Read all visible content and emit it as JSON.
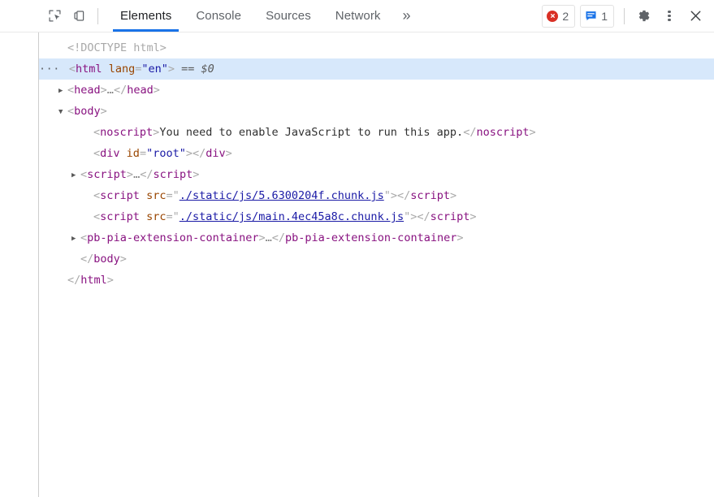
{
  "toolbar": {
    "inspect_icon": "inspect-element-icon",
    "device_icon": "device-toolbar-icon",
    "tabs": [
      {
        "label": "Elements",
        "active": true
      },
      {
        "label": "Console",
        "active": false
      },
      {
        "label": "Sources",
        "active": false
      },
      {
        "label": "Network",
        "active": false
      }
    ],
    "overflow_label": "»",
    "error_count": "2",
    "message_count": "1",
    "settings_icon": "gear-icon",
    "more_icon": "kebab-menu-icon",
    "close_icon": "close-icon",
    "accent_color": "#1a73e8",
    "error_color": "#d93025",
    "message_color": "#1a73e8"
  },
  "dom": {
    "selected_suffix": "== $0",
    "rows": [
      {
        "indent": 1,
        "twisty": "none",
        "leading_dots": false,
        "selected": false,
        "parts": [
          {
            "t": "doctype",
            "v": "<!DOCTYPE html>"
          }
        ]
      },
      {
        "indent": 0,
        "twisty": "none",
        "leading_dots": true,
        "selected": true,
        "parts": [
          {
            "t": "pnct",
            "v": "<"
          },
          {
            "t": "tag",
            "v": "html"
          },
          {
            "t": "pnct",
            "v": " "
          },
          {
            "t": "attn",
            "v": "lang"
          },
          {
            "t": "pnct",
            "v": "="
          },
          {
            "t": "attv",
            "v": "\"en\""
          },
          {
            "t": "pnct",
            "v": ">"
          },
          {
            "t": "sel0",
            "v": " == $0"
          }
        ]
      },
      {
        "indent": 1,
        "twisty": "closed",
        "leading_dots": false,
        "selected": false,
        "parts": [
          {
            "t": "pnct",
            "v": "<"
          },
          {
            "t": "tag",
            "v": "head"
          },
          {
            "t": "pnct",
            "v": ">"
          },
          {
            "t": "ellip",
            "v": "…"
          },
          {
            "t": "pnct",
            "v": "</"
          },
          {
            "t": "tag",
            "v": "head"
          },
          {
            "t": "pnct",
            "v": ">"
          }
        ]
      },
      {
        "indent": 1,
        "twisty": "open",
        "leading_dots": false,
        "selected": false,
        "parts": [
          {
            "t": "pnct",
            "v": "<"
          },
          {
            "t": "tag",
            "v": "body"
          },
          {
            "t": "pnct",
            "v": ">"
          }
        ]
      },
      {
        "indent": 3,
        "twisty": "none",
        "leading_dots": false,
        "selected": false,
        "parts": [
          {
            "t": "pnct",
            "v": "<"
          },
          {
            "t": "tag",
            "v": "noscript"
          },
          {
            "t": "pnct",
            "v": ">"
          },
          {
            "t": "txt",
            "v": "You need to enable JavaScript to run this app."
          },
          {
            "t": "pnct",
            "v": "</"
          },
          {
            "t": "tag",
            "v": "noscript"
          },
          {
            "t": "pnct",
            "v": ">"
          }
        ]
      },
      {
        "indent": 3,
        "twisty": "none",
        "leading_dots": false,
        "selected": false,
        "parts": [
          {
            "t": "pnct",
            "v": "<"
          },
          {
            "t": "tag",
            "v": "div"
          },
          {
            "t": "pnct",
            "v": " "
          },
          {
            "t": "attn",
            "v": "id"
          },
          {
            "t": "pnct",
            "v": "="
          },
          {
            "t": "attv",
            "v": "\"root\""
          },
          {
            "t": "pnct",
            "v": ">"
          },
          {
            "t": "pnct",
            "v": "</"
          },
          {
            "t": "tag",
            "v": "div"
          },
          {
            "t": "pnct",
            "v": ">"
          }
        ]
      },
      {
        "indent": 2,
        "twisty": "closed",
        "leading_dots": false,
        "selected": false,
        "parts": [
          {
            "t": "pnct",
            "v": "<"
          },
          {
            "t": "tag",
            "v": "script"
          },
          {
            "t": "pnct",
            "v": ">"
          },
          {
            "t": "ellip",
            "v": "…"
          },
          {
            "t": "pnct",
            "v": "</"
          },
          {
            "t": "tag",
            "v": "script"
          },
          {
            "t": "pnct",
            "v": ">"
          }
        ]
      },
      {
        "indent": 3,
        "twisty": "none",
        "leading_dots": false,
        "selected": false,
        "parts": [
          {
            "t": "pnct",
            "v": "<"
          },
          {
            "t": "tag",
            "v": "script"
          },
          {
            "t": "pnct",
            "v": " "
          },
          {
            "t": "attn",
            "v": "src"
          },
          {
            "t": "pnct",
            "v": "="
          },
          {
            "t": "pnct",
            "v": "\""
          },
          {
            "t": "link",
            "v": "./static/js/5.6300204f.chunk.js"
          },
          {
            "t": "pnct",
            "v": "\""
          },
          {
            "t": "pnct",
            "v": ">"
          },
          {
            "t": "pnct",
            "v": "</"
          },
          {
            "t": "tag",
            "v": "script"
          },
          {
            "t": "pnct",
            "v": ">"
          }
        ]
      },
      {
        "indent": 3,
        "twisty": "none",
        "leading_dots": false,
        "selected": false,
        "parts": [
          {
            "t": "pnct",
            "v": "<"
          },
          {
            "t": "tag",
            "v": "script"
          },
          {
            "t": "pnct",
            "v": " "
          },
          {
            "t": "attn",
            "v": "src"
          },
          {
            "t": "pnct",
            "v": "="
          },
          {
            "t": "pnct",
            "v": "\""
          },
          {
            "t": "link",
            "v": "./static/js/main.4ec45a8c.chunk.js"
          },
          {
            "t": "pnct",
            "v": "\""
          },
          {
            "t": "pnct",
            "v": ">"
          },
          {
            "t": "pnct",
            "v": "</"
          },
          {
            "t": "tag",
            "v": "script"
          },
          {
            "t": "pnct",
            "v": ">"
          }
        ]
      },
      {
        "indent": 2,
        "twisty": "closed",
        "leading_dots": false,
        "selected": false,
        "parts": [
          {
            "t": "pnct",
            "v": "<"
          },
          {
            "t": "tag",
            "v": "pb-pia-extension-container"
          },
          {
            "t": "pnct",
            "v": ">"
          },
          {
            "t": "ellip",
            "v": "…"
          },
          {
            "t": "pnct",
            "v": "</"
          },
          {
            "t": "tag",
            "v": "pb-pia-extension-container"
          },
          {
            "t": "pnct",
            "v": ">"
          }
        ]
      },
      {
        "indent": 2,
        "twisty": "none",
        "leading_dots": false,
        "selected": false,
        "parts": [
          {
            "t": "pnct",
            "v": "</"
          },
          {
            "t": "tag",
            "v": "body"
          },
          {
            "t": "pnct",
            "v": ">"
          }
        ]
      },
      {
        "indent": 1,
        "twisty": "none",
        "leading_dots": false,
        "selected": false,
        "parts": [
          {
            "t": "pnct",
            "v": "</"
          },
          {
            "t": "tag",
            "v": "html"
          },
          {
            "t": "pnct",
            "v": ">"
          }
        ]
      }
    ]
  }
}
